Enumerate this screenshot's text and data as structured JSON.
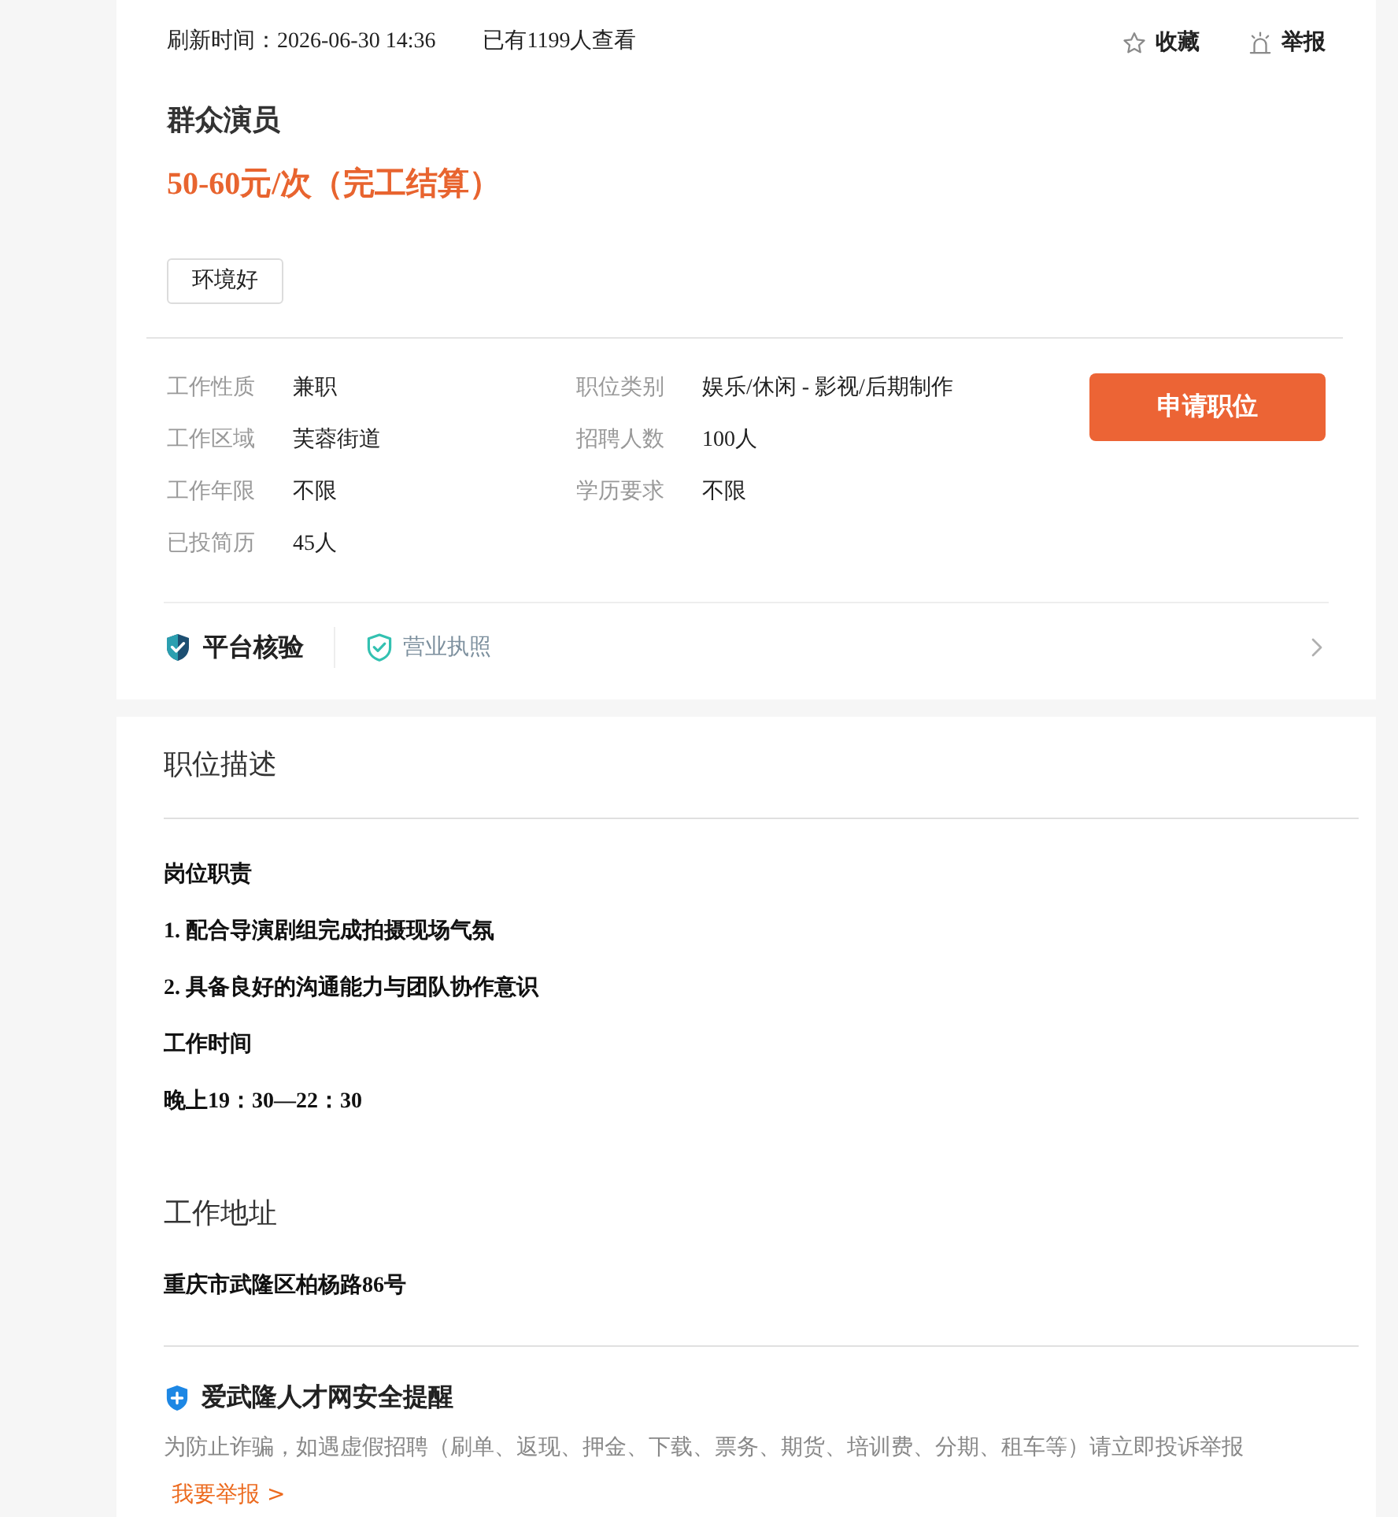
{
  "meta": {
    "refresh": "刷新时间：2026-06-30 14:36",
    "views": "已有1199人查看"
  },
  "actions": [
    {
      "kind": "favorite",
      "label": "收藏"
    },
    {
      "kind": "report",
      "label": "举报"
    }
  ],
  "job": {
    "title": "群众演员",
    "salary": "50-60元/次（完工结算）",
    "tags": [
      "环境好"
    ]
  },
  "details": [
    {
      "label": "工作性质",
      "value": "兼职"
    },
    {
      "label": "职位类别",
      "value": "娱乐/休闲 - 影视/后期制作"
    },
    {
      "label": "工作区域",
      "value": "芙蓉街道"
    },
    {
      "label": "招聘人数",
      "value": "100人"
    },
    {
      "label": "工作年限",
      "value": "不限"
    },
    {
      "label": "学历要求",
      "value": "不限"
    },
    {
      "label": "已投简历",
      "value": "45人"
    }
  ],
  "apply_button": "申请职位",
  "verification": {
    "platform": "平台核验",
    "license": "营业执照"
  },
  "description": {
    "title": "职位描述",
    "lines": [
      "岗位职责",
      "1. 配合导演剧组完成拍摄现场气氛",
      "2. 具备良好的沟通能力与团队协作意识",
      "工作时间",
      "晚上19：30—22：30"
    ]
  },
  "address": {
    "title": "工作地址",
    "text": "重庆市武隆区柏杨路86号"
  },
  "safety": {
    "title": "爱武隆人才网安全提醒",
    "text": "为防止诈骗，如遇虚假招聘（刷单、返现、押金、下载、票务、期货、培训费、分期、租车等）请立即投诉举报",
    "link": "我要举报 >"
  }
}
